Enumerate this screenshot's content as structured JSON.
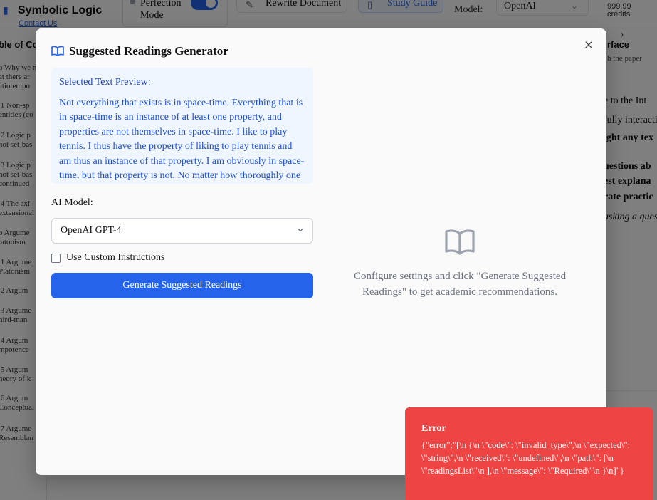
{
  "app": {
    "brand": "Symbolic Logic",
    "brand_sub": "Contact Us",
    "perfection_label": "Perfection Mode",
    "rewrite_label": "Rewrite Document",
    "study_label": "Study Guide",
    "model_label": "Model:",
    "model_value": "OpenAI",
    "credits_value": "999.99",
    "credits_label": "credits",
    "toc_title": "ble of Co",
    "toc_items": [
      "o Why we n",
      "at there ar",
      "atiotempo",
      ".1 Non-sp",
      "entities (co",
      ".2 Logic p",
      "not set-bas",
      ".3 Logic p",
      "not set-bas",
      "continued",
      ".4 The axi",
      "extensional",
      "o Argume",
      "latonism",
      ".1 Argume",
      "Platonism",
      ".2 Argum",
      ".3 Argume",
      "hird-man",
      ".4 Argum",
      "mpotence",
      ".5 Argum",
      "heory of k",
      ".6 Argum",
      "Conceptual",
      ".7 Argume",
      "Resemblan"
    ],
    "right_title": "rface",
    "right_sub": "h the paper",
    "right_lines": [
      "e to the Int",
      "fully interacti",
      "ight any tex",
      "uestions ab",
      "est explana",
      "rate practic",
      "asking a ques"
    ]
  },
  "modal": {
    "title": "Suggested Readings Generator",
    "close_glyph": "×",
    "preview_label": "Selected Text Preview:",
    "preview_text": "Not everything that exists is in space-time. Everything that is in space-time is an instance of at least one property, and properties are not themselves in space-time. I like to play tennis. I thus have the property of liking to play tennis and am thus an instance of that property. I am obviously in space-time, but that property is not. No matter how thoroughly one",
    "ai_model_label": "AI Model:",
    "ai_model_value": "OpenAI GPT-4",
    "custom_instructions_label": "Use Custom Instructions",
    "generate_button": "Generate Suggested Readings",
    "empty_message": "Configure settings and click \"Generate Suggested Readings\" to get academic recommendations."
  },
  "toast": {
    "title": "Error",
    "message": "{\"error\":\"[\\n {\\n \\\"code\\\": \\\"invalid_type\\\",\\n \\\"expected\\\": \\\"string\\\",\\n \\\"received\\\": \\\"undefined\\\",\\n \\\"path\\\": [\\n \\\"readingsList\\\"\\n ],\\n \\\"message\\\": \\\"Required\\\"\\n }\\n]\"}"
  },
  "colors": {
    "accent": "#2563eb",
    "preview_bg": "#eff6ff",
    "error": "#ef4444"
  }
}
